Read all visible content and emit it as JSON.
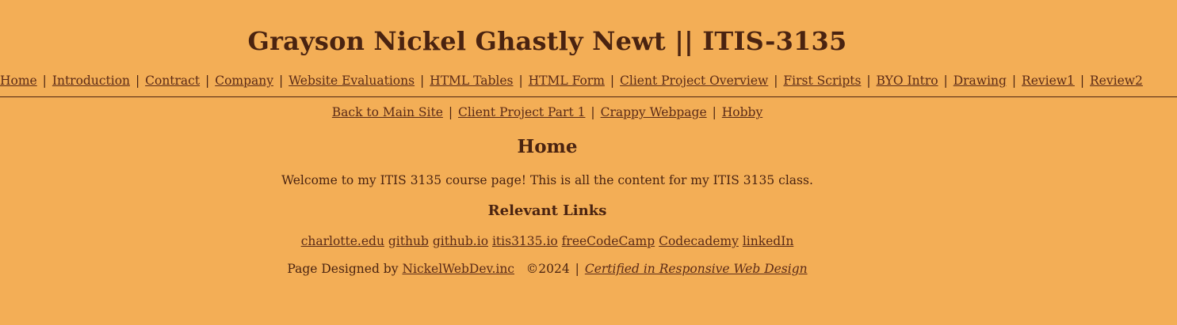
{
  "header": {
    "title": "Grayson Nickel Ghastly Newt || ITIS-3135"
  },
  "main_nav": {
    "separator": "|",
    "items": [
      {
        "label": "Home"
      },
      {
        "label": "Introduction"
      },
      {
        "label": "Contract"
      },
      {
        "label": "Company"
      },
      {
        "label": "Website Evaluations"
      },
      {
        "label": "HTML Tables"
      },
      {
        "label": "HTML Form"
      },
      {
        "label": "Client Project Overview"
      },
      {
        "label": "First Scripts"
      },
      {
        "label": "BYO Intro"
      },
      {
        "label": "Drawing"
      },
      {
        "label": "Review1"
      },
      {
        "label": "Review2"
      }
    ]
  },
  "sub_nav": {
    "items": [
      {
        "label": "Back to Main Site"
      },
      {
        "label": "Client Project Part 1"
      },
      {
        "label": "Crappy Webpage"
      },
      {
        "label": "Hobby"
      }
    ]
  },
  "main": {
    "heading": "Home",
    "welcome": "Welcome to my ITIS 3135 course page! This is all the content for my ITIS 3135 class.",
    "links_heading": "Relevant Links",
    "links": [
      {
        "label": "charlotte.edu"
      },
      {
        "label": "github"
      },
      {
        "label": "github.io"
      },
      {
        "label": "itis3135.io"
      },
      {
        "label": "freeCodeCamp"
      },
      {
        "label": "Codecademy"
      },
      {
        "label": "linkedIn"
      }
    ]
  },
  "footer": {
    "designed_by_prefix": "Page Designed by",
    "designer_link": "NickelWebDev.inc",
    "copyright": "©2024",
    "certification_link": "Certified in Responsive Web Design"
  },
  "colors": {
    "background": "#f3ae56",
    "text": "#4a2310",
    "link": "#5b2a16"
  }
}
